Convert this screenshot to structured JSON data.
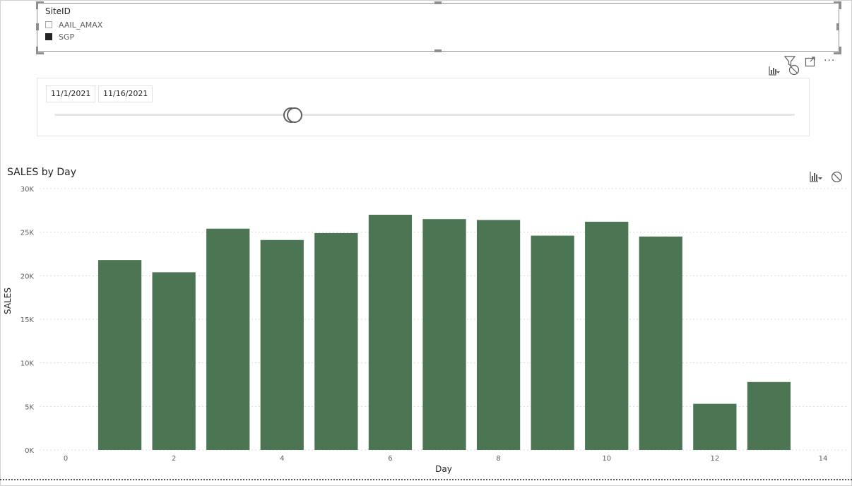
{
  "slicer": {
    "title": "SiteID",
    "items": [
      {
        "label": "AAIL_AMAX",
        "checked": false
      },
      {
        "label": "SGP",
        "checked": true
      }
    ]
  },
  "header_icons": [
    "bar-chart-filter-icon",
    "filter-icon",
    "focus-mode-icon",
    "more-options-icon",
    "no-filter-icon"
  ],
  "date_slicer": {
    "start": "11/1/2021",
    "end": "11/16/2021",
    "thumb_position_fraction": 0.32
  },
  "chart": {
    "title": "SALES by Day",
    "xlabel": "Day",
    "ylabel": "SALES",
    "bar_color": "#4c7653"
  },
  "chart_data": {
    "type": "bar",
    "title": "SALES by Day",
    "xlabel": "Day",
    "ylabel": "SALES",
    "x": [
      1,
      2,
      3,
      4,
      5,
      6,
      7,
      8,
      9,
      10,
      11,
      12,
      13
    ],
    "values": [
      21800,
      20400,
      25400,
      24100,
      24900,
      27000,
      26500,
      26400,
      24600,
      26200,
      24500,
      5300,
      7800
    ],
    "xlim": [
      0,
      14
    ],
    "ylim": [
      0,
      30000
    ],
    "xticks": [
      "0",
      "2",
      "4",
      "6",
      "8",
      "10",
      "12",
      "14"
    ],
    "yticks": [
      "0K",
      "5K",
      "10K",
      "15K",
      "20K",
      "25K",
      "30K"
    ],
    "grid": true
  }
}
